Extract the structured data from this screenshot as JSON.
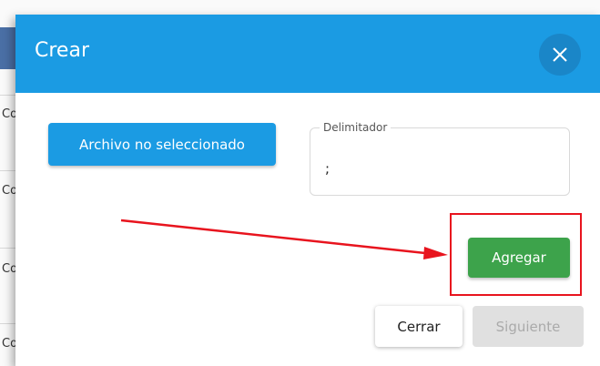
{
  "background": {
    "row_fragment": "Co",
    "bottom_text": "... ..."
  },
  "modal": {
    "title": "Crear",
    "close_icon": "close-icon",
    "file_button_label": "Archivo no seleccionado",
    "delimiter": {
      "label": "Delimitador",
      "value": ";"
    },
    "add_button_label": "Agregar",
    "close_button_label": "Cerrar",
    "next_button_label": "Siguiente"
  },
  "colors": {
    "header": "#1b9be3",
    "primary": "#1b9be3",
    "success": "#3da34b",
    "annotation": "#e8141e",
    "disabled": "#e0e0e0"
  }
}
